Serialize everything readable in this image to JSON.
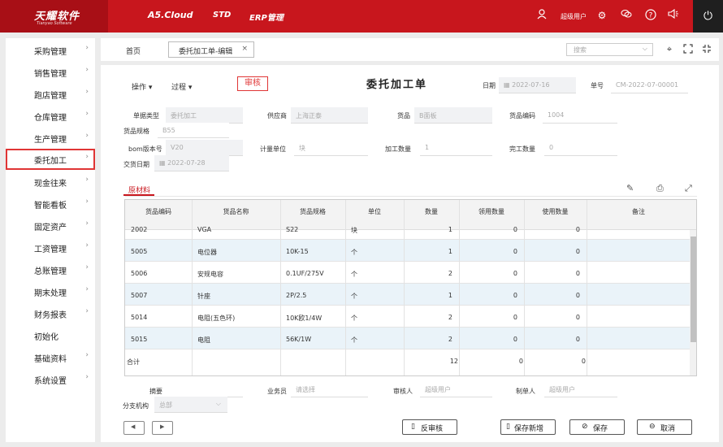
{
  "app": {
    "logo_main": "天耀软件",
    "logo_sub": "Tianyao Software",
    "nav": [
      "A5.Cloud",
      "STD",
      "ERP管理"
    ],
    "user": "超级用户"
  },
  "sidebar": {
    "items": [
      {
        "label": "采购管理",
        "arrow": true
      },
      {
        "label": "销售管理",
        "arrow": true
      },
      {
        "label": "跑店管理",
        "arrow": true
      },
      {
        "label": "仓库管理",
        "arrow": true
      },
      {
        "label": "生产管理",
        "arrow": true
      },
      {
        "label": "委托加工",
        "arrow": true
      },
      {
        "label": "现金往来",
        "arrow": true
      },
      {
        "label": "智能看板",
        "arrow": true
      },
      {
        "label": "固定资产",
        "arrow": true
      },
      {
        "label": "工资管理",
        "arrow": true
      },
      {
        "label": "总账管理",
        "arrow": true
      },
      {
        "label": "期末处理",
        "arrow": true
      },
      {
        "label": "财务报表",
        "arrow": true
      },
      {
        "label": "初始化",
        "arrow": false
      },
      {
        "label": "基础资料",
        "arrow": true
      },
      {
        "label": "系统设置",
        "arrow": true
      }
    ],
    "active_index": 5
  },
  "tabs": {
    "home": "首页",
    "active": "委托加工单-编辑",
    "close": "×",
    "search_placeholder": "搜索"
  },
  "form": {
    "operate": "操作",
    "process": "过程",
    "audit_tag": "审核",
    "title": "委托加工单",
    "date_label": "日期",
    "date_value": "2022-07-16",
    "no_label": "单号",
    "no_value": "CM-2022-07-00001",
    "doc_type_label": "单据类型",
    "doc_type_value": "委托加工",
    "supplier_label": "供应商",
    "supplier_value": "上海正泰",
    "goods_label": "货品",
    "goods_value": "B面板",
    "goods_code_label": "货品编码",
    "goods_code_value": "1004",
    "goods_spec_label": "货品规格",
    "goods_spec_value": "B55",
    "bom_label": "bom版本号",
    "bom_value": "V20",
    "unit_label": "计量单位",
    "unit_value": "块",
    "qty_label": "加工数量",
    "qty_value": "1",
    "done_label": "完工数量",
    "done_value": "0",
    "delivery_label": "交货日期",
    "delivery_value": "2022-07-28"
  },
  "materials": {
    "tab_label": "原材料",
    "columns": [
      "货品编码",
      "货品名称",
      "货品规格",
      "单位",
      "数量",
      "领用数量",
      "使用数量",
      "备注"
    ],
    "rows": [
      {
        "code": "2002",
        "name": "VGA",
        "spec": "S22",
        "unit": "块",
        "qty": "1",
        "issued": "0",
        "used": "0",
        "note": ""
      },
      {
        "code": "5005",
        "name": "电位器",
        "spec": "10K-15",
        "unit": "个",
        "qty": "1",
        "issued": "0",
        "used": "0",
        "note": ""
      },
      {
        "code": "5006",
        "name": "安规电容",
        "spec": "0.1UF/275V",
        "unit": "个",
        "qty": "2",
        "issued": "0",
        "used": "0",
        "note": ""
      },
      {
        "code": "5007",
        "name": "针座",
        "spec": "2P/2.5",
        "unit": "个",
        "qty": "1",
        "issued": "0",
        "used": "0",
        "note": ""
      },
      {
        "code": "5014",
        "name": "电阻(五色环)",
        "spec": "10K欧1/4W",
        "unit": "个",
        "qty": "2",
        "issued": "0",
        "used": "0",
        "note": ""
      },
      {
        "code": "5015",
        "name": "电阻",
        "spec": "56K/1W",
        "unit": "个",
        "qty": "2",
        "issued": "0",
        "used": "0",
        "note": ""
      }
    ],
    "total_label": "合计",
    "total_qty": "12",
    "total_issued": "0",
    "total_used": "0"
  },
  "footer": {
    "summary_label": "摘要",
    "summary_value": "",
    "salesman_label": "业务员",
    "salesman_placeholder": "请选择",
    "auditor_label": "审核人",
    "auditor_value": "超级用户",
    "maker_label": "制单人",
    "maker_value": "超级用户",
    "branch_label": "分支机构",
    "branch_value": "总部"
  },
  "buttons": {
    "prev": "◀",
    "next": "▶",
    "unaudit": "反审核",
    "save_new": "保存新增",
    "save": "保存",
    "cancel": "取消"
  }
}
